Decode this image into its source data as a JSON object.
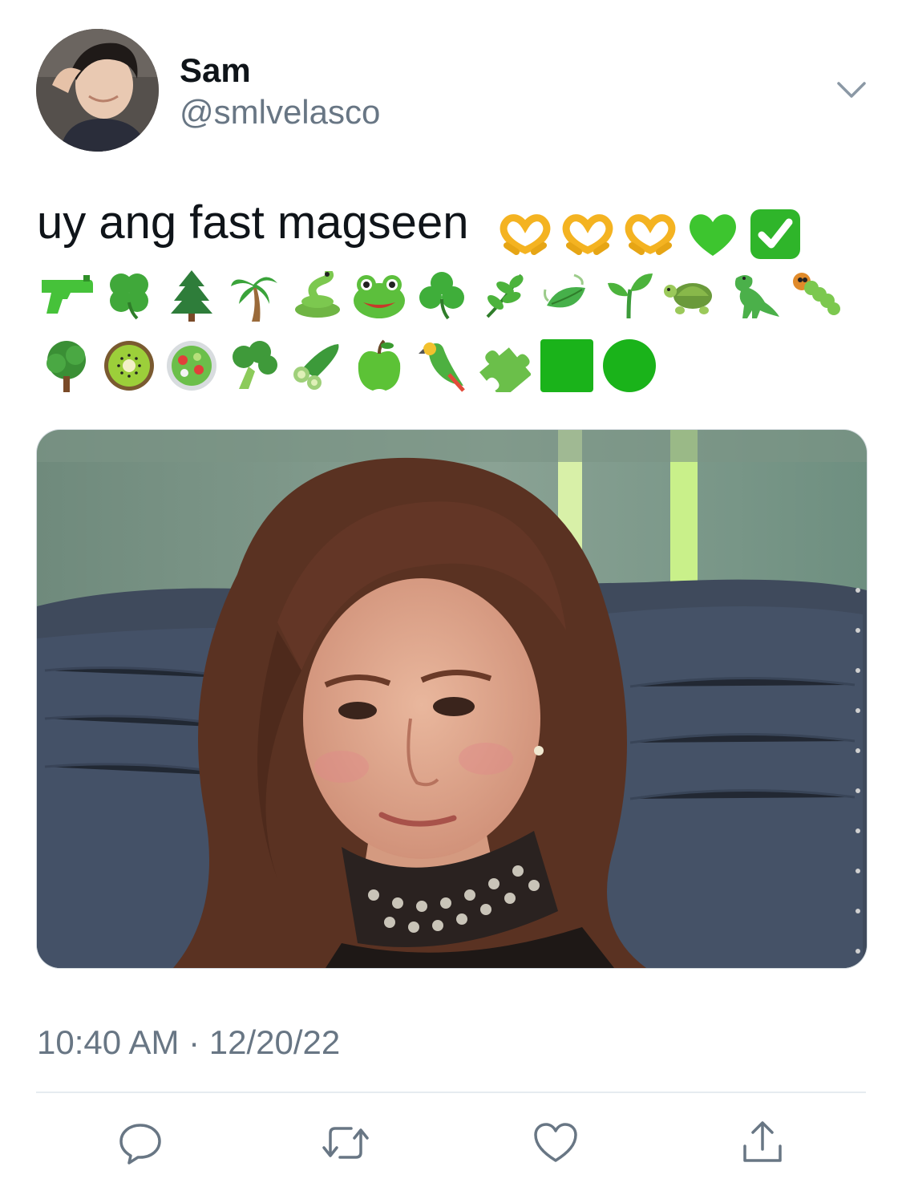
{
  "header": {
    "display_name": "Sam",
    "handle": "@smlvelasco"
  },
  "tweet": {
    "text": "uy ang fast magseen",
    "emoji_line_1": [
      "heart-hands",
      "heart-hands",
      "heart-hands",
      "green-heart",
      "check-mark-button"
    ],
    "emoji_line_2": [
      "water-pistol",
      "four-leaf-clover",
      "evergreen-tree",
      "palm-tree",
      "snake",
      "frog",
      "shamrock",
      "herb",
      "leaf-fluttering",
      "seedling",
      "turtle",
      "t-rex",
      "bug"
    ],
    "emoji_line_3": [
      "deciduous-tree",
      "kiwi",
      "salad",
      "broccoli",
      "cucumber",
      "green-apple",
      "parrot",
      "puzzle-piece",
      "green-square",
      "green-circle"
    ],
    "timestamp": "10:40 AM · 12/20/22"
  },
  "media": {
    "description_icon": "photo"
  },
  "actions": {
    "reply_icon": "reply-icon",
    "retweet_icon": "retweet-icon",
    "like_icon": "like-icon",
    "share_icon": "share-icon"
  },
  "colors": {
    "text": "#0f1419",
    "secondary": "#687684",
    "divider": "#e6ecf0",
    "emoji_green": "#3fae2a"
  }
}
